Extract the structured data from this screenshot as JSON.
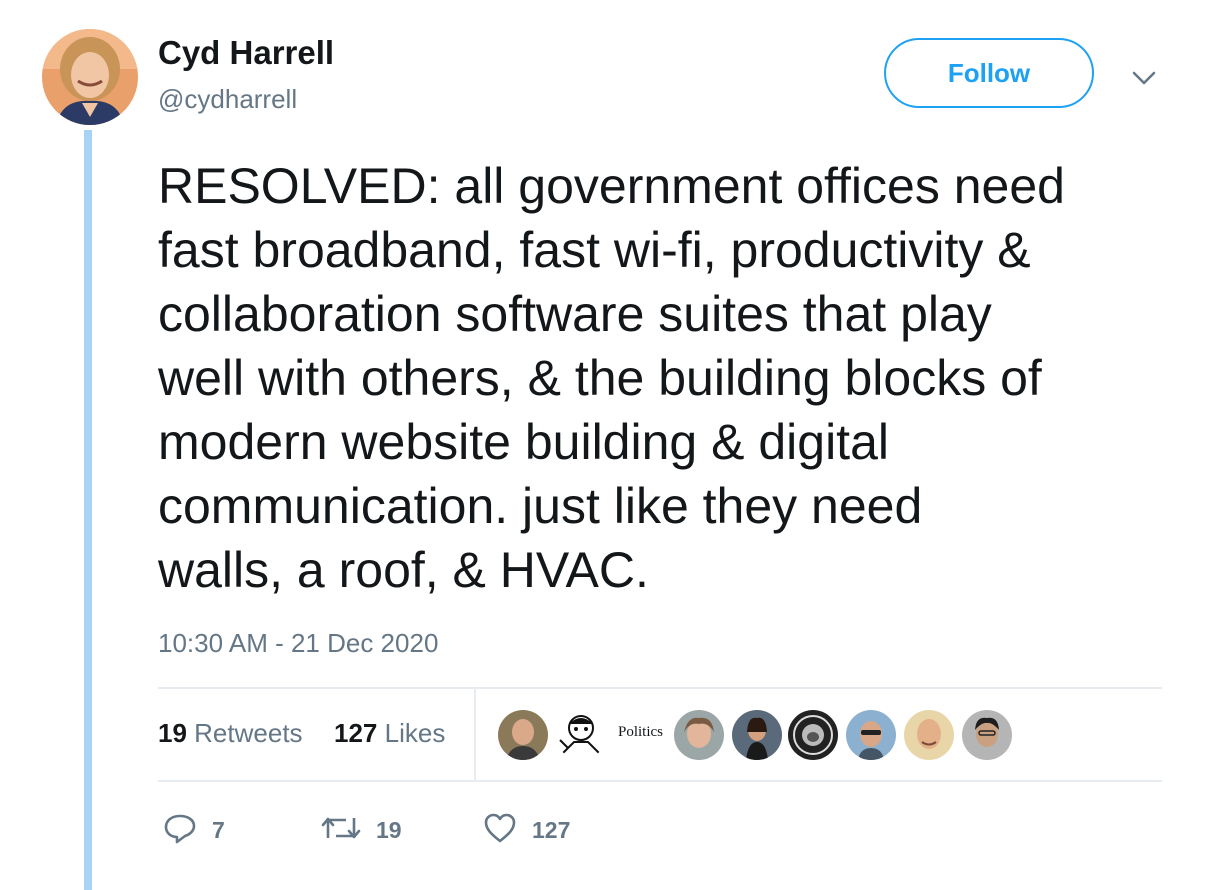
{
  "author": {
    "display_name": "Cyd Harrell",
    "handle": "@cydharrell"
  },
  "follow_label": "Follow",
  "tweet": {
    "text": "RESOLVED: all government offices need\nfast broadband, fast wi-fi, productivity &\ncollaboration software suites that play\nwell with others, & the building blocks of\nmodern website building & digital\ncommunication. just like they need\nwalls, a roof, & HVAC.",
    "timestamp": "10:30 AM - 21 Dec 2020"
  },
  "stats": {
    "retweets_count": "19",
    "retweets_label": "Retweets",
    "likes_count": "127",
    "likes_label": "Likes"
  },
  "likers_badge_text": "Politics",
  "actions": {
    "reply_count": "7",
    "retweet_count": "19",
    "like_count": "127"
  },
  "colors": {
    "accent": "#1da1f2",
    "thread_line": "#a9d3f5",
    "secondary_text": "#657786",
    "divider": "#e6ecf0"
  }
}
